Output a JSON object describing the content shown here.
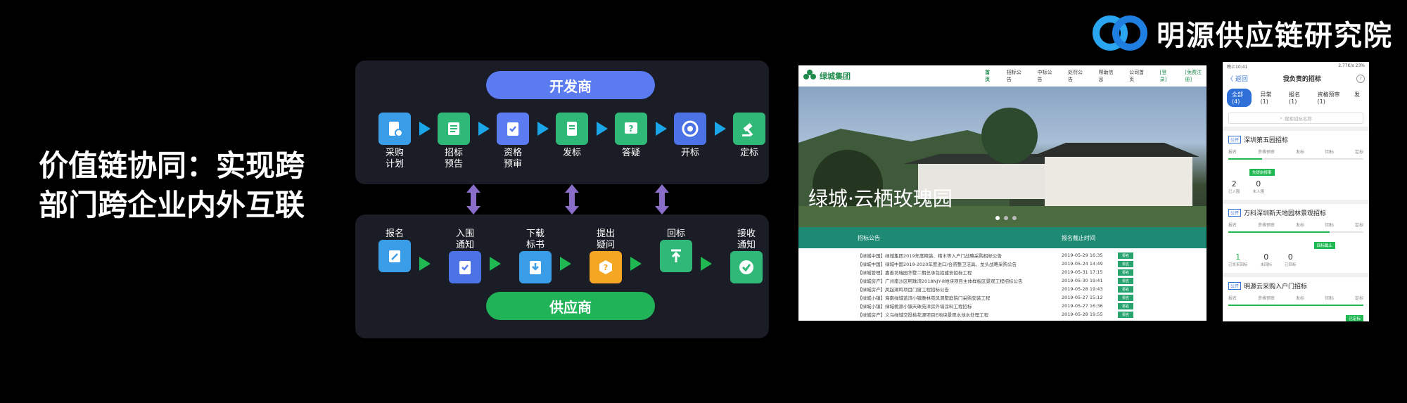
{
  "brand": {
    "name": "明源供应链研究院",
    "logo_icon": "link-logo-icon"
  },
  "headline": {
    "line1": "价值链协同：实现跨",
    "line2": "部门跨企业内外互联"
  },
  "colors": {
    "developer": "#5b7bf0",
    "supplier": "#20b357",
    "blue_arrow": "#1aa6e8",
    "green_arrow": "#1fb852",
    "purple_link": "#8a6cc9"
  },
  "developer_flow": {
    "title": "开发商",
    "steps": [
      {
        "label": "采购\n计划",
        "icon": "plan-doc-icon",
        "color": "#3a9de8"
      },
      {
        "label": "招标\n预告",
        "icon": "notice-list-icon",
        "color": "#2fb877"
      },
      {
        "label": "资格\n预审",
        "icon": "check-clipboard-icon",
        "color": "#5b7bf0"
      },
      {
        "label": "发标",
        "icon": "doc-icon",
        "color": "#2fb877"
      },
      {
        "label": "答疑",
        "icon": "question-icon",
        "color": "#2fb877"
      },
      {
        "label": "开标",
        "icon": "target-icon",
        "color": "#4b73e6"
      },
      {
        "label": "定标",
        "icon": "gavel-icon",
        "color": "#2fb877"
      }
    ]
  },
  "supplier_flow": {
    "title": "供应商",
    "steps": [
      {
        "label": "报名",
        "icon": "edit-icon",
        "color": "#3a9de8"
      },
      {
        "label": "入围\n通知",
        "icon": "check-clipboard-icon",
        "color": "#4b73e6"
      },
      {
        "label": "下载\n标书",
        "icon": "download-icon",
        "color": "#3a9de8"
      },
      {
        "label": "提出\n疑问",
        "icon": "question-hex-icon",
        "color": "#f5a623"
      },
      {
        "label": "回标",
        "icon": "upload-icon",
        "color": "#2fb877"
      },
      {
        "label": "接收\n通知",
        "icon": "check-circle-icon",
        "color": "#2fb877"
      }
    ]
  },
  "website": {
    "logo": "绿城集团",
    "nav": [
      "首页",
      "招标公告",
      "中标公告",
      "处罚公告",
      "帮助信息",
      "公司首页",
      "[登录]",
      "[免费注册]"
    ],
    "hero_title": "绿城·云栖玫瑰园",
    "table_headers": [
      "招标公告",
      "报名截止时间"
    ],
    "rows": [
      {
        "title": "【绿城中国】绿城集团2019年度精装、精木等入户门战略采购招标公告",
        "date": "2019-05-29 16:35"
      },
      {
        "title": "【绿城中国】绿城中国2019-2020年度进口/合资整卫洁具、龙头战略采购公告",
        "date": "2019-05-24 14:49"
      },
      {
        "title": "【绿城管理】嘉善坊瑞园华墅二期总承包招建安招标工程",
        "date": "2019-05-31 17:15"
      },
      {
        "title": "【绿城房产】广州南沙区明珠湾2018NJY-8地块项目主体样板区景观工程招标公告",
        "date": "2019-05-30 19:41"
      },
      {
        "title": "【绿城房产】凤起潮鸣项目门窗工程招标公告",
        "date": "2019-05-28 19:43"
      },
      {
        "title": "【绿城小镇】海南绿城蓝湾小镇雅林苑风洞墅庭院门采购安装工程",
        "date": "2019-05-27 15:12"
      },
      {
        "title": "【绿城小镇】绿城桃源小镇天珠苑洋房外墙涂料工程招标",
        "date": "2019-05-27 16:36"
      },
      {
        "title": "【绿城房产】义乌绿城交投桃花源项目E地块景观水池水处理工程",
        "date": "2019-05-28 19:55"
      }
    ],
    "row_button": "报名"
  },
  "mobile": {
    "status_left": "晚上10:41",
    "status_right": "2.77K/s  23%",
    "back": "〈 返回",
    "title": "我负责的招标",
    "tabs": [
      "全部(4)",
      "异常(1)",
      "报名(1)",
      "资格预审(1)",
      "发"
    ],
    "search_placeholder": "搜索招标名称",
    "cards": [
      {
        "tag": "公开",
        "name": "深圳第五园招标",
        "stages": [
          "报名",
          "资格预审",
          "发标",
          "回标",
          "定标"
        ],
        "progress": 0.25,
        "badge": "先提前报事",
        "stats": [
          {
            "value": "2",
            "label": "已入围"
          },
          {
            "value": "0",
            "label": "未入围"
          }
        ]
      },
      {
        "tag": "公开",
        "name": "万科深圳新天地园林景观招标",
        "stages": [
          "报名",
          "资格预审",
          "发标",
          "回标",
          "定标"
        ],
        "progress": 0.75,
        "badge": "回标截止",
        "stats": [
          {
            "value": "1",
            "label": "已发来回标"
          },
          {
            "value": "0",
            "label": "未回标"
          },
          {
            "value": "0",
            "label": "已回标"
          }
        ]
      },
      {
        "tag": "公开",
        "name": "明源云采购入户门招标",
        "stages": [
          "报名",
          "资格预审",
          "发标",
          "回标",
          "定标"
        ],
        "progress": 1.0,
        "badge": "已定标",
        "stats": []
      }
    ]
  }
}
